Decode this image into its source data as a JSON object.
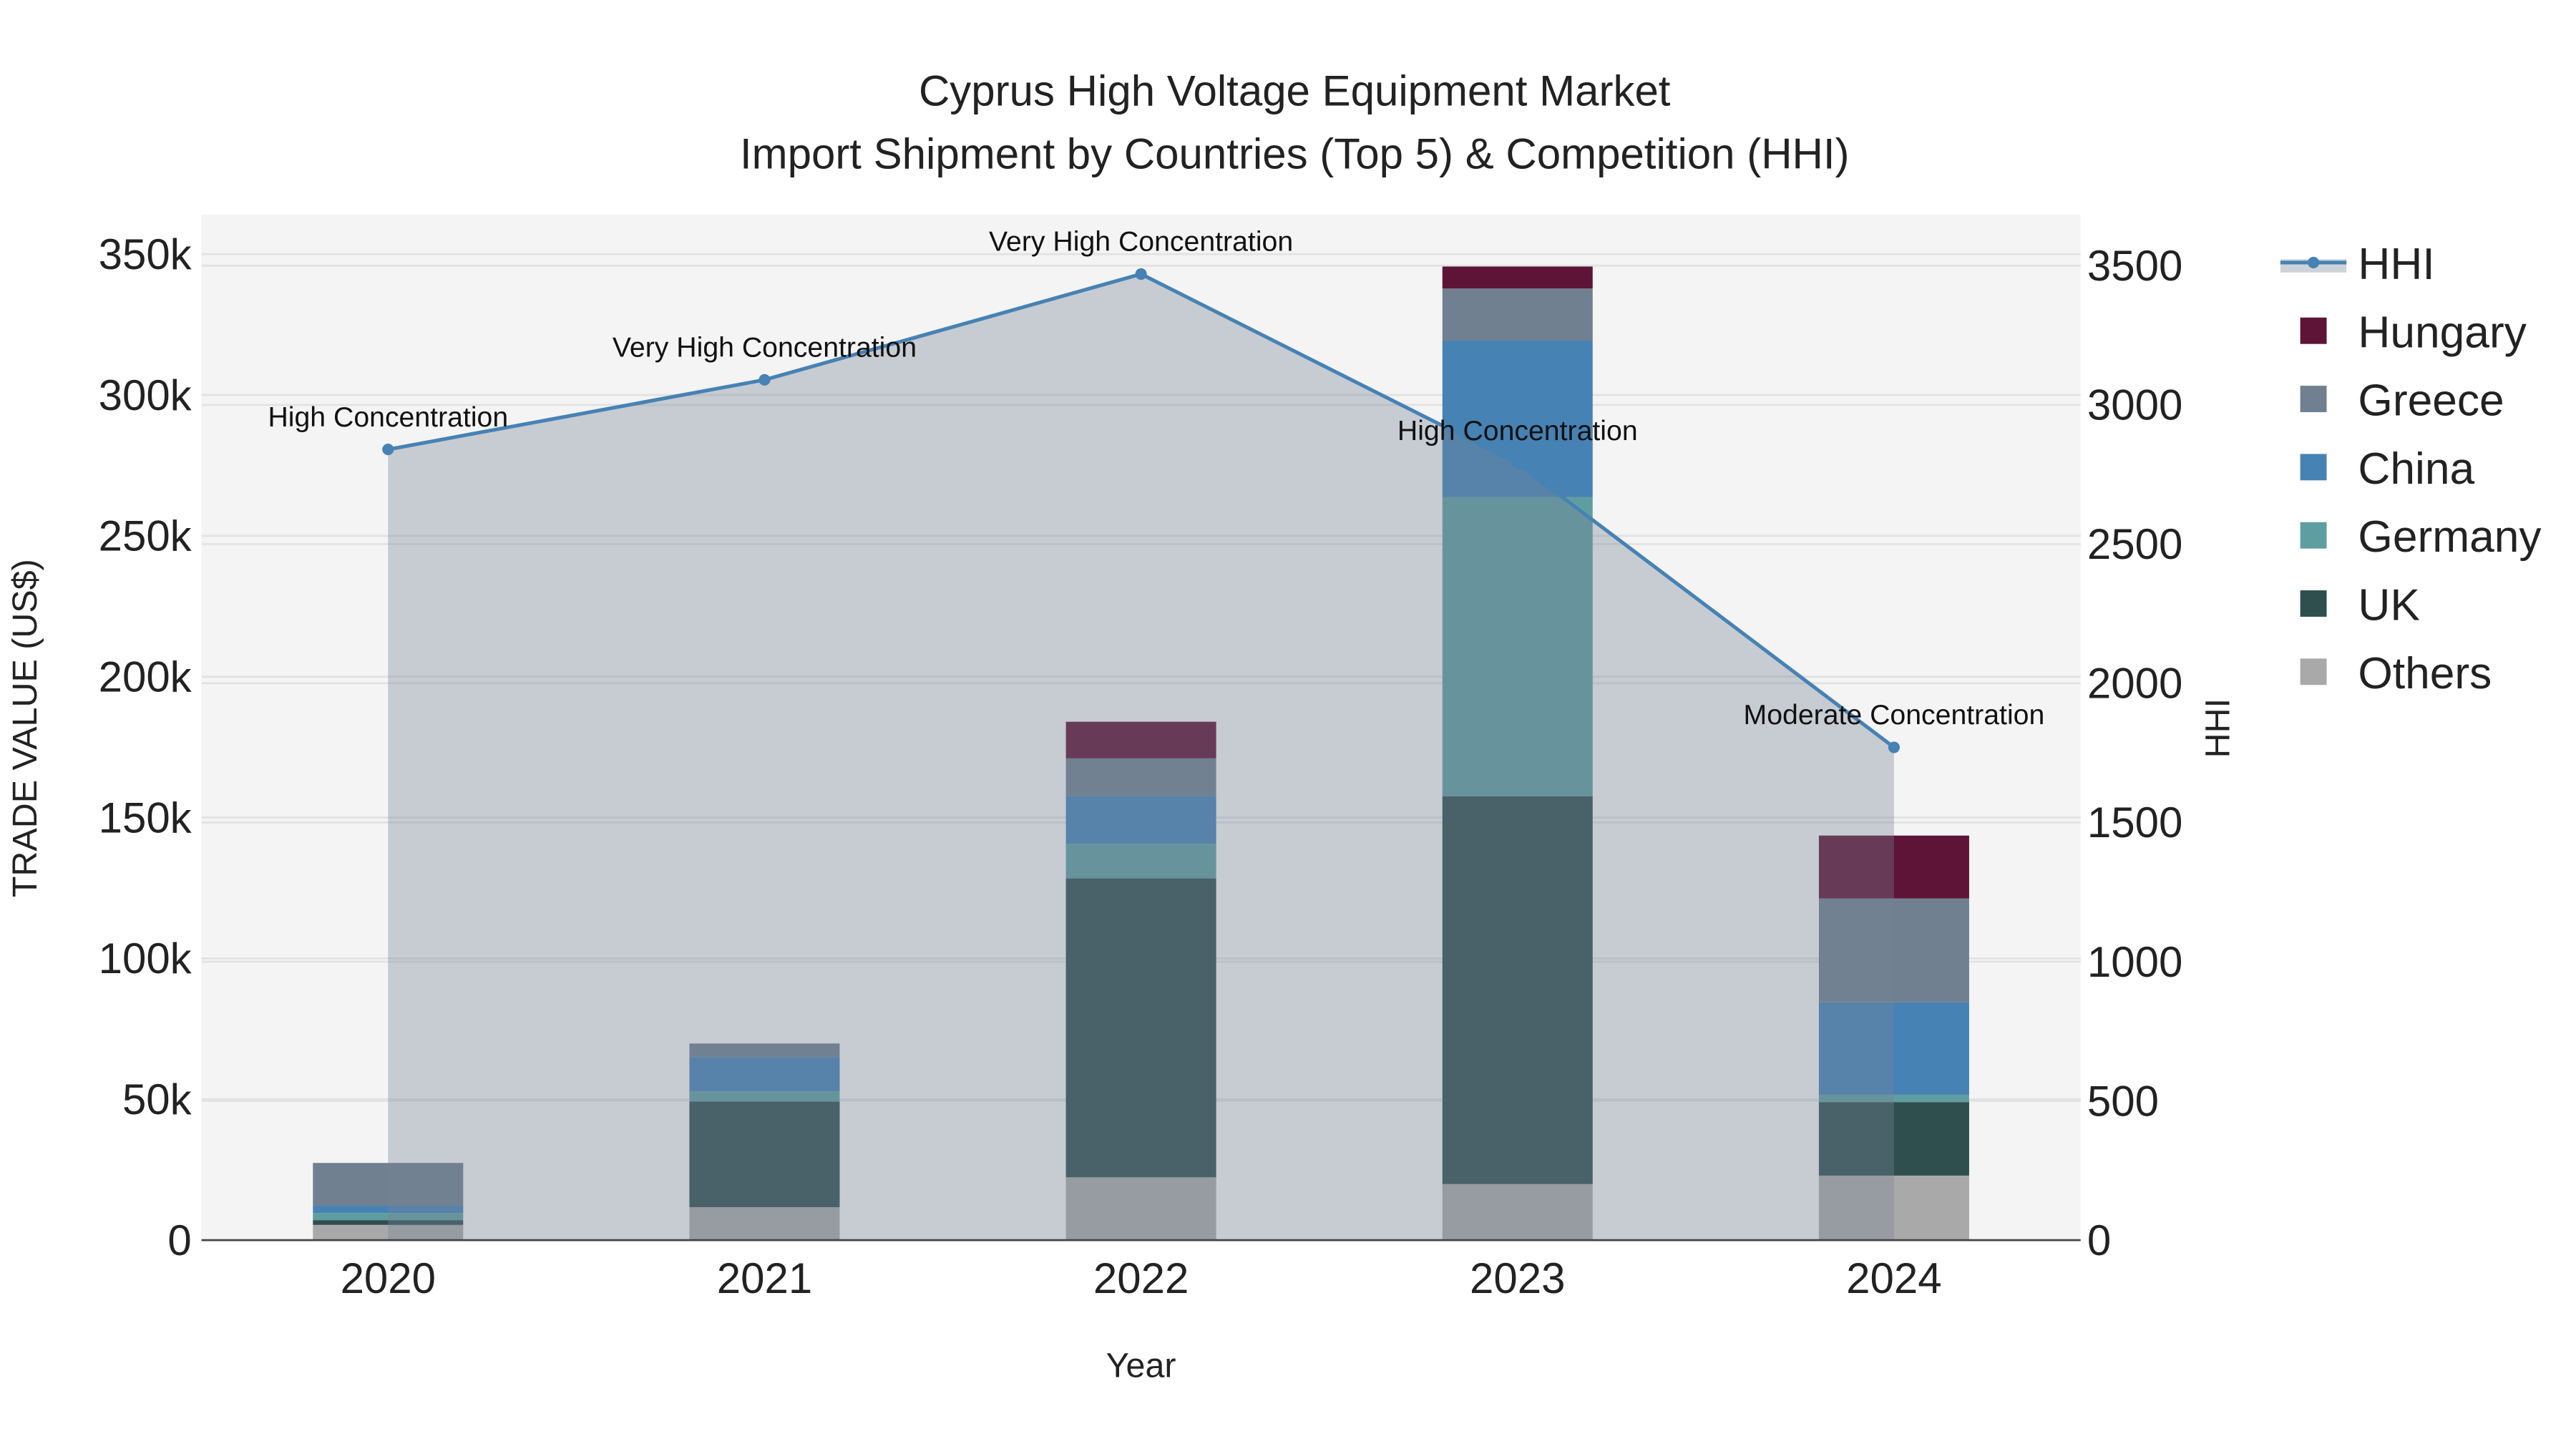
{
  "chart_data": {
    "type": "bar",
    "title": "Cyprus High Voltage Equipment Market",
    "subtitle": "Import Shipment by Countries (Top 5) & Competition (HHI)",
    "xlabel": "Year",
    "ylabel": "TRADE VALUE (US$)",
    "y2label": "HHI",
    "categories": [
      "2020",
      "2021",
      "2022",
      "2023",
      "2024"
    ],
    "ylim": [
      0,
      365000
    ],
    "y2lim": [
      0,
      3680
    ],
    "yticks": [
      0,
      50000,
      100000,
      150000,
      200000,
      250000,
      300000,
      350000
    ],
    "ytick_labels": [
      "0",
      "50k",
      "100k",
      "150k",
      "200k",
      "250k",
      "300k",
      "350k"
    ],
    "y2ticks": [
      0,
      500,
      1000,
      1500,
      2000,
      2500,
      3000,
      3500
    ],
    "y2tick_labels": [
      "0",
      "500",
      "1000",
      "1500",
      "2000",
      "2500",
      "3000",
      "3500"
    ],
    "grid": true,
    "stacked": true,
    "legend_position": "right",
    "series": [
      {
        "name": "Others",
        "color": "#a9a9a9",
        "values": [
          5400,
          11700,
          22300,
          19900,
          22900
        ]
      },
      {
        "name": "UK",
        "color": "#2f4f4f",
        "values": [
          1700,
          37500,
          106100,
          137600,
          26100
        ]
      },
      {
        "name": "Germany",
        "color": "#5f9ea0",
        "values": [
          2500,
          3600,
          12300,
          106300,
          2600
        ]
      },
      {
        "name": "China",
        "color": "#4682b4",
        "values": [
          2600,
          12200,
          17000,
          55500,
          32800
        ]
      },
      {
        "name": "Greece",
        "color": "#708090",
        "values": [
          15200,
          4800,
          13300,
          18500,
          36900
        ]
      },
      {
        "name": "Hungary",
        "color": "#5e1436",
        "values": [
          0,
          0,
          13000,
          7800,
          22300
        ]
      }
    ],
    "line_series": {
      "name": "HHI",
      "color": "#4682b4",
      "values": [
        2840,
        3090,
        3470,
        2790,
        1770
      ],
      "annotations": [
        "High Concentration",
        "Very High Concentration",
        "Very High Concentration",
        "High Concentration",
        "Moderate Concentration"
      ]
    },
    "legend": [
      "HHI",
      "Hungary",
      "Greece",
      "China",
      "Germany",
      "UK",
      "Others"
    ]
  }
}
